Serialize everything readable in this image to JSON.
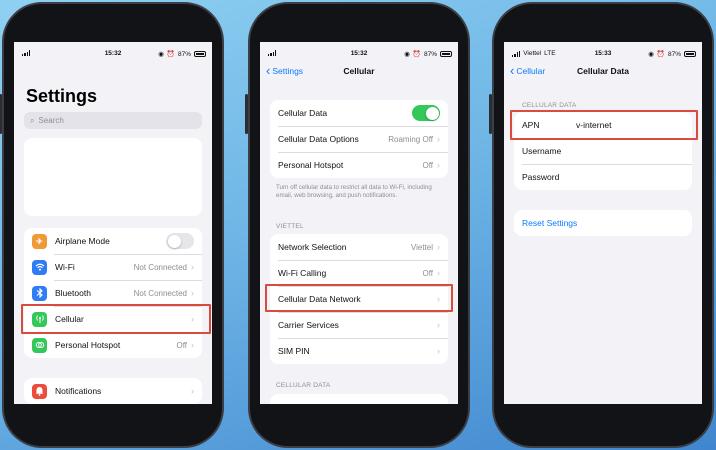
{
  "screens": [
    {
      "status": {
        "time": "15:32",
        "carrier": "",
        "network": "",
        "battery": "87%"
      },
      "title": "Settings",
      "search_placeholder": "Search",
      "rows": [
        {
          "label": "Airplane Mode",
          "value": "",
          "icon": "airplane-icon",
          "color": "#f09a37",
          "toggle": "off"
        },
        {
          "label": "Wi-Fi",
          "value": "Not Connected",
          "icon": "wifi-icon",
          "color": "#2f7cf6"
        },
        {
          "label": "Bluetooth",
          "value": "Not Connected",
          "icon": "bluetooth-icon",
          "color": "#2f7cf6"
        },
        {
          "label": "Cellular",
          "value": "",
          "icon": "cellular-antenna-icon",
          "color": "#34c759"
        },
        {
          "label": "Personal Hotspot",
          "value": "Off",
          "icon": "hotspot-icon",
          "color": "#34c759"
        }
      ],
      "rows2": [
        {
          "label": "Notifications",
          "icon": "bell-icon",
          "color": "#eb4d3d"
        }
      ]
    },
    {
      "status": {
        "time": "15:32",
        "battery": "87%"
      },
      "back": "Settings",
      "title": "Cellular",
      "group1": [
        {
          "label": "Cellular Data",
          "toggle": "on"
        },
        {
          "label": "Cellular Data Options",
          "value": "Roaming Off"
        },
        {
          "label": "Personal Hotspot",
          "value": "Off"
        }
      ],
      "footnote": "Turn off cellular data to restrict all data to Wi-Fi, including email, web browsing, and push notifications.",
      "section_viettel": "VIETTEL",
      "group2": [
        {
          "label": "Network Selection",
          "value": "Viettel"
        },
        {
          "label": "Wi-Fi Calling",
          "value": "Off"
        },
        {
          "label": "Cellular Data Network",
          "value": ""
        },
        {
          "label": "Carrier Services",
          "value": ""
        },
        {
          "label": "SIM PIN",
          "value": ""
        }
      ],
      "section_cellular_data": "CELLULAR DATA"
    },
    {
      "status": {
        "time": "15:33",
        "carrier": "Viettel",
        "network": "LTE",
        "battery": "87%"
      },
      "back": "Cellular",
      "title": "Cellular Data",
      "section": "CELLULAR DATA",
      "apn_label": "APN",
      "apn_value": "v-internet",
      "username_label": "Username",
      "password_label": "Password",
      "reset_label": "Reset Settings"
    }
  ],
  "colors": {
    "highlight": "#d84b3e",
    "ios_blue": "#0a7aff",
    "toggle_on": "#34c759"
  }
}
